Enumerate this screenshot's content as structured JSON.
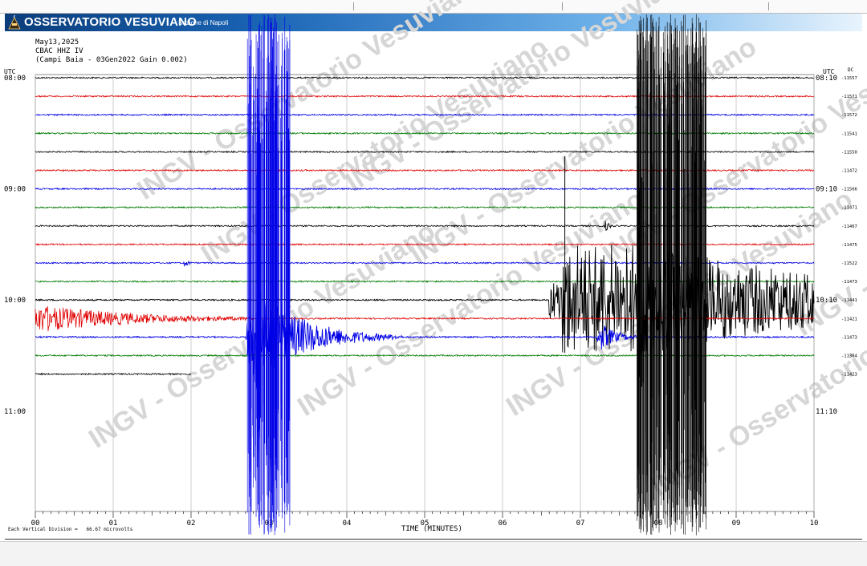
{
  "header": {
    "brand": "OSSERVATORIO VESUVIANO",
    "section": "Sezione di Napoli"
  },
  "info": {
    "date": "May13,2025",
    "station": "CBAC HHZ IV",
    "station_detail": "(Campi Baia - 03Gen2022 Gain 0.002)"
  },
  "footer": {
    "scale_note": "Each Vertical Division =   66.67 microvolts"
  },
  "watermark": "INGV - Osservatorio Vesuviano",
  "colors": {
    "black": "#000000",
    "red": "#e00000",
    "blue": "#0000e6",
    "green": "#007a00",
    "grid": "#b8b8b8",
    "header_dark": "#0b3d7a",
    "header_light": "#6fb2ea"
  },
  "chart_data": {
    "type": "line",
    "chart_kind": "helicorder seismogram",
    "xlabel": "TIME (MINUTES)",
    "x_ticks": [
      "00",
      "01",
      "02",
      "03",
      "04",
      "05",
      "06",
      "07",
      "08",
      "09",
      "10"
    ],
    "xlim": [
      0,
      10
    ],
    "left_label": "UTC",
    "right_label": "UTC",
    "right_unit": "DC",
    "left_hours": [
      "08:00",
      "09:00",
      "10:00",
      "11:00"
    ],
    "right_hours": [
      "08:10",
      "09:10",
      "10:10",
      "11:10"
    ],
    "trace_colors_cycle": [
      "black",
      "red",
      "blue",
      "green"
    ],
    "traces": [
      {
        "index": 0,
        "color": "black",
        "dc": "-11557"
      },
      {
        "index": 1,
        "color": "red",
        "dc": "-11571"
      },
      {
        "index": 2,
        "color": "blue",
        "dc": "-11572"
      },
      {
        "index": 3,
        "color": "green",
        "dc": "-11541"
      },
      {
        "index": 4,
        "color": "black",
        "dc": "-11550"
      },
      {
        "index": 5,
        "color": "red",
        "dc": "-11472"
      },
      {
        "index": 6,
        "color": "blue",
        "dc": "-11566"
      },
      {
        "index": 7,
        "color": "green",
        "dc": "-11471"
      },
      {
        "index": 8,
        "color": "black",
        "dc": "-11467"
      },
      {
        "index": 9,
        "color": "red",
        "dc": "-11475"
      },
      {
        "index": 10,
        "color": "blue",
        "dc": "-11522"
      },
      {
        "index": 11,
        "color": "green",
        "dc": "-11473"
      },
      {
        "index": 12,
        "color": "black",
        "dc": "-11441"
      },
      {
        "index": 13,
        "color": "red",
        "dc": "-11421"
      },
      {
        "index": 14,
        "color": "blue",
        "dc": "-11473"
      },
      {
        "index": 15,
        "color": "green",
        "dc": "-11384"
      },
      {
        "index": 16,
        "color": "black",
        "dc": "-11423",
        "end_minute": 2.0
      }
    ],
    "events": [
      {
        "name": "small event",
        "trace": 10,
        "start_minute": 1.9,
        "duration_minute": 0.15,
        "amplitude": "small"
      },
      {
        "name": "large event A",
        "trace": 14,
        "start_minute": 2.7,
        "duration_minute": 2.0,
        "amplitude": "very large"
      },
      {
        "name": "coda red",
        "trace": 13,
        "start_minute": 0.0,
        "duration_minute": 2.8,
        "amplitude": "medium"
      },
      {
        "name": "large event B",
        "trace": 12,
        "start_minute": 6.6,
        "duration_minute": 3.4,
        "amplitude": "very large"
      },
      {
        "name": "event B blue",
        "trace": 14,
        "start_minute": 7.2,
        "duration_minute": 0.6,
        "amplitude": "medium"
      },
      {
        "name": "small event black",
        "trace": 8,
        "start_minute": 7.3,
        "duration_minute": 0.2,
        "amplitude": "small"
      }
    ]
  }
}
